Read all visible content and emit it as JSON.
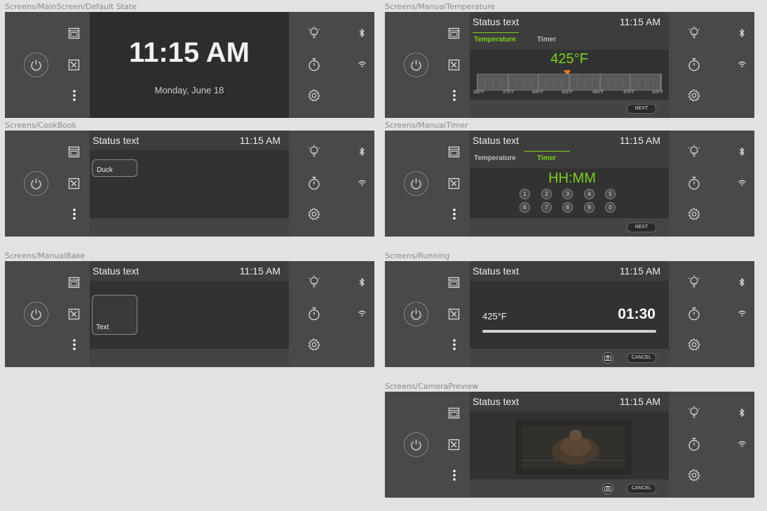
{
  "frames": {
    "main": {
      "label": "Screens/MainScreen/Default State",
      "time": "11:15 AM",
      "date": "Monday, June 18"
    },
    "manual_temp": {
      "label": "Screens/ManualTemperature",
      "status": "Status text",
      "time": "11:15 AM",
      "tab_temperature": "Temperature",
      "tab_timer": "Timer",
      "temperature": "425°F",
      "ticks": [
        "350°F",
        "375°F",
        "400°F",
        "425°F",
        "450°F",
        "475°F",
        "500°F"
      ],
      "next": "NEXT"
    },
    "cookbook": {
      "label": "Screens/CookBook",
      "status": "Status text",
      "time": "11:15 AM",
      "item": "Duck"
    },
    "manual_timer": {
      "label": "Screens/ManualTimer",
      "status": "Status text",
      "time": "11:15 AM",
      "tab_temperature": "Temperature",
      "tab_timer": "Timer",
      "timer_placeholder": "HH:MM",
      "keys": [
        "1",
        "2",
        "3",
        "4",
        "5",
        "6",
        "7",
        "8",
        "9",
        "0"
      ],
      "next": "NEXT"
    },
    "manual_bake": {
      "label": "Screens/ManualBake",
      "status": "Status text",
      "time": "11:15 AM",
      "card_text": "Text"
    },
    "running": {
      "label": "Screens/Running",
      "status": "Status text",
      "time": "11:15 AM",
      "temperature": "425°F",
      "countdown": "01:30",
      "cancel": "CANCEL",
      "progress": 1.0
    },
    "camera": {
      "label": "Screens/CameraPreview",
      "status": "Status text",
      "time": "11:15 AM",
      "cancel": "CANCEL"
    }
  },
  "colors": {
    "accent": "#7ad11c",
    "temp_text": "#7ad11c",
    "marker": "#f07d1a",
    "canvas": "#e2e2e2",
    "panel": "#494949",
    "screen": "#323232"
  },
  "icons": {
    "left": [
      "power-icon",
      "oven-icon",
      "cookbook-icon",
      "more-vertical-icon"
    ],
    "right": [
      "light-bulb-icon",
      "bluetooth-icon",
      "timer-icon",
      "wifi-icon",
      "settings-gear-icon"
    ]
  }
}
